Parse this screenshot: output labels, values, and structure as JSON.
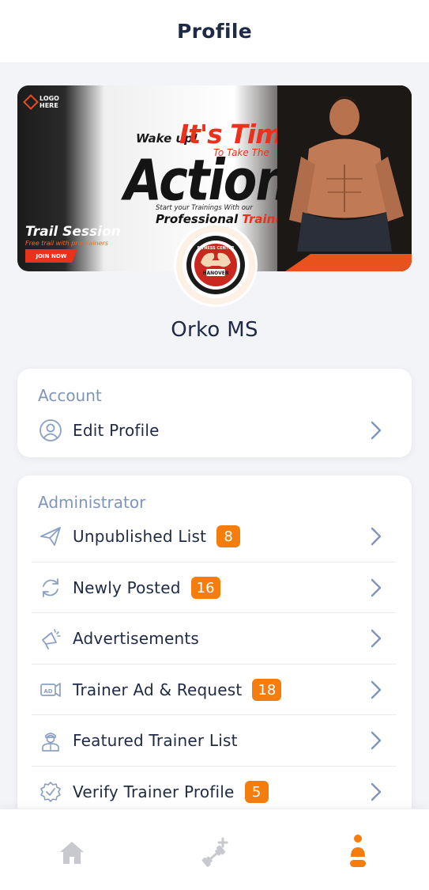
{
  "header": {
    "title": "Profile"
  },
  "banner": {
    "logo_text": "LOGO HERE",
    "wake_up": "Wake up!",
    "its_time": "It's Time",
    "to_take_the": "To Take The",
    "action": "Action",
    "start_text": "Start your Trainings With our",
    "professional": "Professional",
    "trainers": "Trainers",
    "trail_session": "Trail Session",
    "trail_sub": "Free trail with pro trainers",
    "join_now": "JOIN NOW"
  },
  "avatar": {
    "ring_top": "FITNESS CENTER",
    "ring_bottom": "HANOVER",
    "est": "EST. 2018"
  },
  "user": {
    "name": "Orko MS"
  },
  "account": {
    "title": "Account",
    "items": [
      {
        "label": "Edit Profile",
        "icon": "user-circle-icon"
      }
    ]
  },
  "administrator": {
    "title": "Administrator",
    "items": [
      {
        "label": "Unpublished List",
        "badge": "8",
        "icon": "paper-plane-icon"
      },
      {
        "label": "Newly Posted",
        "badge": "16",
        "icon": "refresh-icon"
      },
      {
        "label": "Advertisements",
        "badge": "",
        "icon": "megaphone-icon"
      },
      {
        "label": "Trainer Ad & Request",
        "badge": "18",
        "icon": "ad-board-icon"
      },
      {
        "label": "Featured Trainer List",
        "badge": "",
        "icon": "trainer-person-icon"
      },
      {
        "label": "Verify Trainer Profile",
        "badge": "5",
        "icon": "verified-badge-icon"
      }
    ]
  },
  "bottom_nav": [
    {
      "name": "home-icon",
      "active": false
    },
    {
      "name": "workout-add-icon",
      "active": false
    },
    {
      "name": "profile-icon",
      "active": true
    }
  ],
  "colors": {
    "accent": "#f47d0e",
    "title": "#1f2a44",
    "section": "#7f95ba",
    "icon": "#8aa0c4",
    "nav_inactive": "#c7c9ce"
  }
}
